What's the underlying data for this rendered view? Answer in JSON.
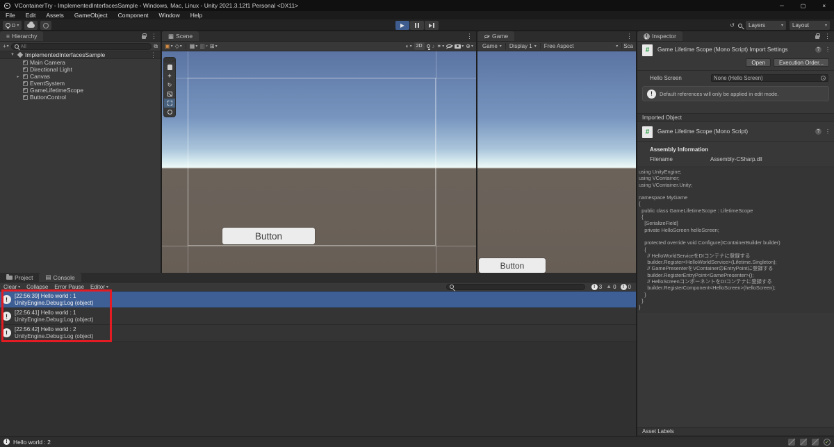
{
  "window": {
    "title": "VContainerTry - ImplementedInterfacesSample - Windows, Mac, Linux - Unity 2021.3.12f1 Personal <DX11>"
  },
  "menu": {
    "items": [
      "File",
      "Edit",
      "Assets",
      "GameObject",
      "Component",
      "Window",
      "Help"
    ]
  },
  "toolbar": {
    "account_label": "D",
    "layers_label": "Layers",
    "layout_label": "Layout"
  },
  "hierarchy": {
    "tab_label": "Hierarchy",
    "create_button": "+",
    "search_placeholder": "All",
    "scene_name": "ImplementedInterfacesSample",
    "items": [
      {
        "label": "Main Camera",
        "expandable": false
      },
      {
        "label": "Directional Light",
        "expandable": false
      },
      {
        "label": "Canvas",
        "expandable": true
      },
      {
        "label": "EventSystem",
        "expandable": false
      },
      {
        "label": "GameLifetimeScope",
        "expandable": false
      },
      {
        "label": "ButtonControl",
        "expandable": false
      }
    ]
  },
  "scene_view": {
    "tab_label": "Scene",
    "mode_2d_label": "2D",
    "canvas_button_label": "Button"
  },
  "game_view": {
    "tab_label": "Game",
    "display_mode": "Game",
    "display_target": "Display 1",
    "aspect": "Free Aspect",
    "scale_label_truncated": "Sca",
    "button_label": "Button"
  },
  "inspector": {
    "tab_label": "Inspector",
    "import_header": "Game Lifetime Scope (Mono Script) Import Settings",
    "open_button": "Open",
    "execution_order_button": "Execution Order...",
    "hello_screen_label": "Hello Screen",
    "hello_screen_value": "None (Hello Screen)",
    "helpbox_text": "Default references will only be applied in edit mode.",
    "imported_object_header": "Imported Object",
    "script_header": "Game Lifetime Scope (Mono Script)",
    "assembly_information_label": "Assembly Information",
    "filename_label": "Filename",
    "filename_value": "Assembly-CSharp.dll",
    "script_icon_glyph": "#",
    "code_lines": [
      "using UnityEngine;",
      "using VContainer;",
      "using VContainer.Unity;",
      "",
      "namespace MyGame",
      "{",
      "  public class GameLifetimeScope : LifetimeScope",
      "  {",
      "    [SerializeField]",
      "    private HelloScreen helloScreen;",
      "",
      "    protected override void Configure(IContainerBuilder builder)",
      "    {",
      "      // HelloWorldServiceをDIコンテナに登録する",
      "      builder.Register<HelloWorldService>(Lifetime.Singleton);",
      "      // GamePresenterをVContainerのEntryPointに登録する",
      "      builder.RegisterEntryPoint<GamePresenter>();",
      "      // HelloScreenコンポーネントをDIコンテナに登録する",
      "      builder.RegisterComponent<HelloScreen>(helloScreen);",
      "    }",
      "  }",
      "}"
    ],
    "asset_labels_header": "Asset Labels"
  },
  "console": {
    "project_tab_label": "Project",
    "console_tab_label": "Console",
    "clear_button": "Clear",
    "collapse_button": "Collapse",
    "error_pause_button": "Error Pause",
    "editor_button": "Editor",
    "counts": {
      "info": "3",
      "warning": "0",
      "error": "0"
    },
    "logs": [
      {
        "line1": "[22:56:39] Hello world : 1",
        "line2": "UnityEngine.Debug:Log (object)",
        "selected": true
      },
      {
        "line1": "[22:56:41] Hello world : 1",
        "line2": "UnityEngine.Debug:Log (object)",
        "selected": false
      },
      {
        "line1": "[22:56:42] Hello world : 2",
        "line2": "UnityEngine.Debug:Log (object)",
        "selected": false
      }
    ]
  },
  "status_bar": {
    "message": "Hello world : 2"
  },
  "icons": {
    "caret_down": "▾",
    "arrow_right": "▸",
    "arrow_down": "▼",
    "kebab": "⋮",
    "hamburger": "≡",
    "minimize": "─",
    "maximize": "▢",
    "close": "×",
    "exclamation": "!",
    "question": "?",
    "check": "✓",
    "grip_dots": "···",
    "rotate": "↻",
    "history": "↺",
    "sphere": "◐",
    "fx": "✶",
    "audio": "♪",
    "gizmo": "⊕",
    "grid": "▦",
    "grid_alt": "▥",
    "grid_plus": "⊞",
    "console_glyph": "▤",
    "tool_rect_active": "▣",
    "pivot": "◇"
  },
  "colors": {
    "selection_blue": "#3e5f96",
    "annotation_red": "#e31b23",
    "play_active": "#3e5c8e",
    "panel_bg": "#383838",
    "sky_top": "#5b74a3",
    "ground": "#6b635a"
  }
}
